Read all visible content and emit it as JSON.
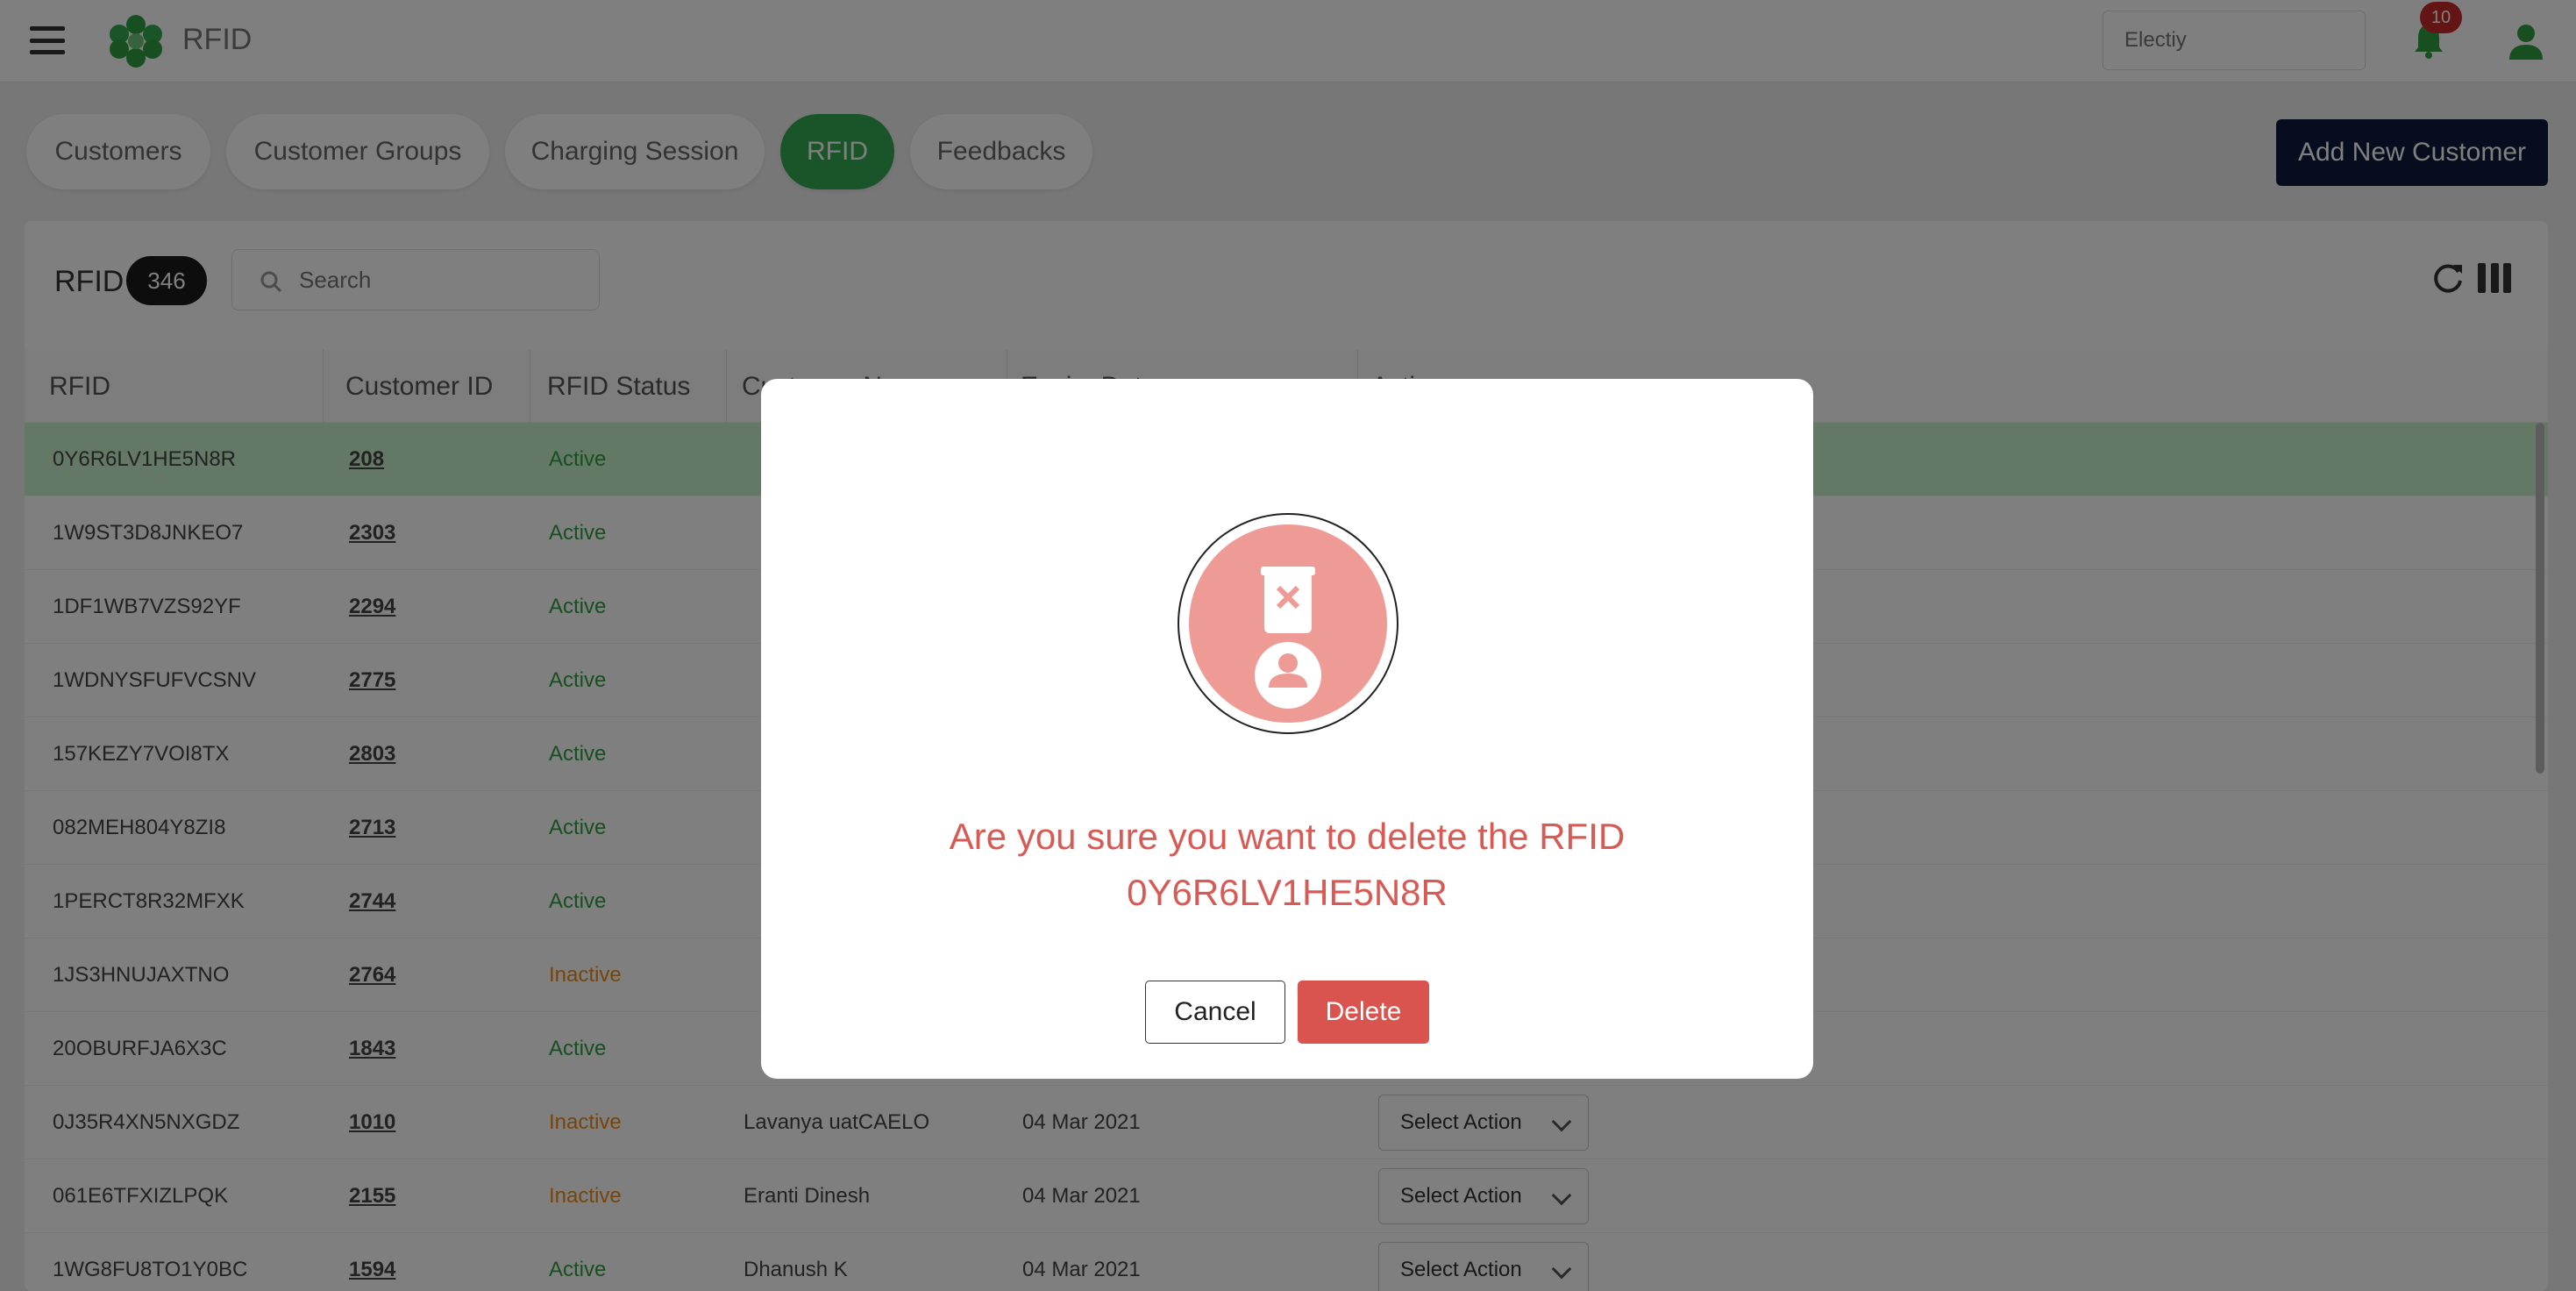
{
  "header": {
    "app_title": "RFID",
    "location_placeholder": "Electiy",
    "notification_count": "10"
  },
  "tabs": [
    {
      "label": "Customers"
    },
    {
      "label": "Customer Groups"
    },
    {
      "label": "Charging Session"
    },
    {
      "label": "RFID",
      "active": true
    },
    {
      "label": "Feedbacks"
    }
  ],
  "add_button_label": "Add New Customer",
  "card": {
    "title": "RFID",
    "count": "346",
    "search_placeholder": "Search"
  },
  "columns": [
    "RFID",
    "Customer ID",
    "RFID Status",
    "Customer Name",
    "Expiry Date",
    "Action"
  ],
  "rows": [
    {
      "rfid": "0Y6R6LV1HE5N8R",
      "customer_id": "208",
      "status": "Active",
      "name": "",
      "date": "",
      "action": ""
    },
    {
      "rfid": "1W9ST3D8JNKEO7",
      "customer_id": "2303",
      "status": "Active",
      "name": "",
      "date": "",
      "action": ""
    },
    {
      "rfid": "1DF1WB7VZS92YF",
      "customer_id": "2294",
      "status": "Active",
      "name": "",
      "date": "",
      "action": ""
    },
    {
      "rfid": "1WDNYSFUFVCSNV",
      "customer_id": "2775",
      "status": "Active",
      "name": "",
      "date": "",
      "action": ""
    },
    {
      "rfid": "157KEZY7VOI8TX",
      "customer_id": "2803",
      "status": "Active",
      "name": "",
      "date": "",
      "action": ""
    },
    {
      "rfid": "082MEH804Y8ZI8",
      "customer_id": "2713",
      "status": "Active",
      "name": "",
      "date": "",
      "action": ""
    },
    {
      "rfid": "1PERCT8R32MFXK",
      "customer_id": "2744",
      "status": "Active",
      "name": "",
      "date": "",
      "action": ""
    },
    {
      "rfid": "1JS3HNUJAXTNO",
      "customer_id": "2764",
      "status": "Inactive",
      "name": "",
      "date": "",
      "action": ""
    },
    {
      "rfid": "20OBURFJA6X3C",
      "customer_id": "1843",
      "status": "Active",
      "name": "",
      "date": "",
      "action": ""
    },
    {
      "rfid": "0J35R4XN5NXGDZ",
      "customer_id": "1010",
      "status": "Inactive",
      "name": "Lavanya uatCAELO",
      "date": "04 Mar 2021",
      "action": "Select Action"
    },
    {
      "rfid": "061E6TFXIZLPQK",
      "customer_id": "2155",
      "status": "Inactive",
      "name": "Eranti Dinesh",
      "date": "04 Mar 2021",
      "action": "Select Action"
    },
    {
      "rfid": "1WG8FU8TO1Y0BC",
      "customer_id": "1594",
      "status": "Active",
      "name": "Dhanush K",
      "date": "04 Mar 2021",
      "action": "Select Action"
    }
  ],
  "modal": {
    "message_line1": "Are you sure you want to delete the RFID",
    "message_line2": "0Y6R6LV1HE5N8R",
    "cancel_label": "Cancel",
    "delete_label": "Delete"
  },
  "colors": {
    "brand_green": "#34a853",
    "navy": "#0f1a3d",
    "danger": "#d9534f",
    "highlight_row": "#c8f0cc"
  }
}
